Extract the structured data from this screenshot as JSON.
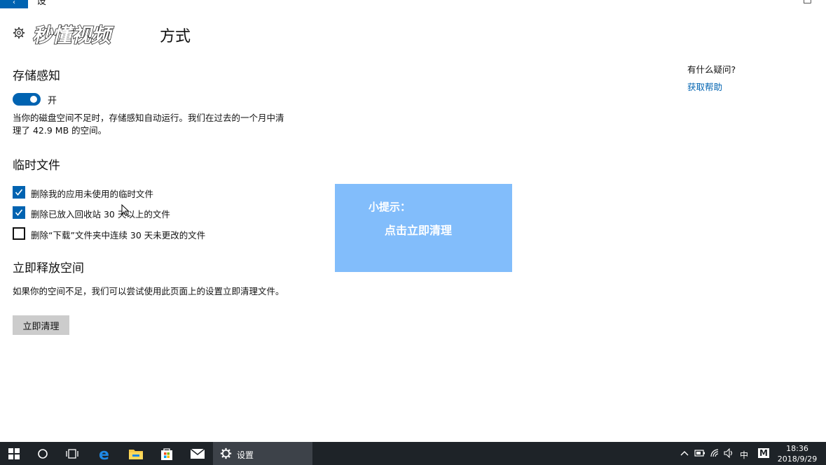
{
  "window": {
    "back_glyph": "‹",
    "top_fragment": "设",
    "top_right_fragment": "□"
  },
  "header": {
    "watermark_text": "秒懂视频",
    "title": "方式"
  },
  "storage_sense": {
    "heading": "存储感知",
    "toggle_state": "on",
    "toggle_label": "开",
    "description": "当你的磁盘空间不足时，存储感知自动运行。我们在过去的一个月中清理了 42.9 MB 的空间。"
  },
  "temp_files": {
    "heading": "临时文件",
    "options": [
      {
        "label": "删除我的应用未使用的临时文件",
        "checked": true
      },
      {
        "label": "删除已放入回收站 30 天以上的文件",
        "checked": true
      },
      {
        "label": "删除“下载”文件夹中连续 30 天未更改的文件",
        "checked": false
      }
    ]
  },
  "free_space": {
    "heading": "立即释放空间",
    "description": "如果你的空间不足，我们可以尝试使用此页面上的设置立即清理文件。",
    "button_label": "立即清理"
  },
  "help": {
    "question": "有什么疑问?",
    "link": "获取帮助"
  },
  "tip": {
    "title": "小提示：",
    "text": "点击立即清理"
  },
  "taskbar": {
    "active_app_label": "设置",
    "ime_label": "中",
    "ime_mode": "M",
    "time": "18:36",
    "date": "2018/9/29"
  },
  "colors": {
    "accent": "#0063b1",
    "tip_bg": "#82bdfb",
    "taskbar_bg": "#1e2328"
  }
}
